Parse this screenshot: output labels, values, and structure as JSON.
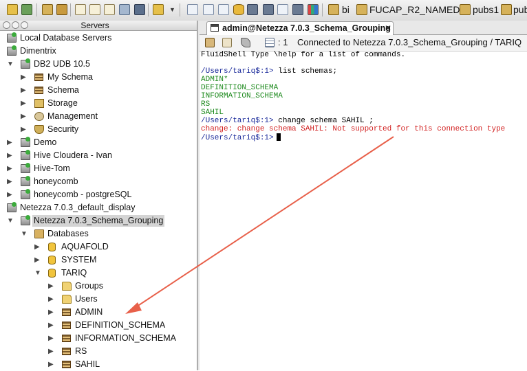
{
  "toolbar": {
    "items": [
      "toolbar-icon",
      "toolbar-icon",
      "toolbar-icon",
      "toolbar-icon",
      "toolbar-icon",
      "toolbar-icon",
      "toolbar-icon",
      "toolbar-icon",
      "toolbar-icon"
    ],
    "connections": [
      "bi",
      "FUCAP_R2_NAMED",
      "pubs1",
      "pub"
    ]
  },
  "servers_panel": {
    "title": "Servers",
    "tree": [
      {
        "label": "Local Database Servers",
        "icon": "server-group-icon",
        "depth": 0,
        "expander": ""
      },
      {
        "label": "Dimentrix",
        "icon": "server-icon",
        "depth": 0,
        "expander": ""
      },
      {
        "label": "DB2 UDB 10.5",
        "icon": "server-icon",
        "depth": 0,
        "expander": "open"
      },
      {
        "label": "My Schema",
        "icon": "schema-icon",
        "depth": 1,
        "expander": "closed"
      },
      {
        "label": "Schema",
        "icon": "schema-icon",
        "depth": 1,
        "expander": "closed"
      },
      {
        "label": "Storage",
        "icon": "storage-icon",
        "depth": 1,
        "expander": "closed"
      },
      {
        "label": "Management",
        "icon": "gear-icon",
        "depth": 1,
        "expander": "closed"
      },
      {
        "label": "Security",
        "icon": "shield-icon",
        "depth": 1,
        "expander": "closed"
      },
      {
        "label": "Demo",
        "icon": "server-icon",
        "depth": 0,
        "expander": "closed"
      },
      {
        "label": "Hive Cloudera - Ivan",
        "icon": "server-icon",
        "depth": 0,
        "expander": "closed"
      },
      {
        "label": "Hive-Tom",
        "icon": "server-icon",
        "depth": 0,
        "expander": "closed"
      },
      {
        "label": "honeycomb",
        "icon": "server-icon",
        "depth": 0,
        "expander": "closed"
      },
      {
        "label": "honeycomb - postgreSQL",
        "icon": "server-icon",
        "depth": 0,
        "expander": "closed"
      },
      {
        "label": "Netezza 7.0.3_default_display",
        "icon": "server-icon",
        "depth": 0,
        "expander": ""
      },
      {
        "label": "Netezza 7.0.3_Schema_Grouping",
        "icon": "server-icon",
        "depth": 0,
        "expander": "open",
        "selected": true
      },
      {
        "label": "Databases",
        "icon": "databases-folder-icon",
        "depth": 1,
        "expander": "open"
      },
      {
        "label": "AQUAFOLD",
        "icon": "database-icon",
        "depth": 2,
        "expander": "closed"
      },
      {
        "label": "SYSTEM",
        "icon": "database-icon",
        "depth": 2,
        "expander": "closed"
      },
      {
        "label": "TARIQ",
        "icon": "database-icon",
        "depth": 2,
        "expander": "open"
      },
      {
        "label": "Groups",
        "icon": "folder-icon",
        "depth": 3,
        "expander": "closed"
      },
      {
        "label": "Users",
        "icon": "folder-icon",
        "depth": 3,
        "expander": "closed"
      },
      {
        "label": "ADMIN",
        "icon": "schema-icon",
        "depth": 3,
        "expander": "closed"
      },
      {
        "label": "DEFINITION_SCHEMA",
        "icon": "schema-icon",
        "depth": 3,
        "expander": "closed"
      },
      {
        "label": "INFORMATION_SCHEMA",
        "icon": "schema-icon",
        "depth": 3,
        "expander": "closed"
      },
      {
        "label": "RS",
        "icon": "schema-icon",
        "depth": 3,
        "expander": "closed"
      },
      {
        "label": "SAHIL",
        "icon": "schema-icon",
        "depth": 3,
        "expander": "closed"
      }
    ]
  },
  "editor": {
    "tab_title": "admin@Netezza 7.0.3_Schema_Grouping",
    "tab_close": "✕",
    "shell_count": ": 1",
    "status": "Connected to Netezza 7.0.3_Schema_Grouping / TARIQ",
    "console": [
      {
        "text": "FluidShell Type \\help for a list of commands.",
        "style": "black"
      },
      {
        "text": "",
        "style": "black"
      },
      {
        "prompt": "/Users/tariq$:1>",
        "text": " list schemas;",
        "style": "cmd"
      },
      {
        "text": "ADMIN*",
        "style": "green"
      },
      {
        "text": "DEFINITION_SCHEMA",
        "style": "green"
      },
      {
        "text": "INFORMATION_SCHEMA",
        "style": "green"
      },
      {
        "text": "RS",
        "style": "green"
      },
      {
        "text": "SAHIL",
        "style": "green"
      },
      {
        "prompt": "/Users/tariq$:1>",
        "text": " change schema SAHIL ;",
        "style": "cmd"
      },
      {
        "text": "change: change schema SAHIL: Not supported for this connection type",
        "style": "err"
      },
      {
        "prompt": "/Users/tariq$:1>",
        "text": "",
        "style": "cmd",
        "cursor": true
      }
    ]
  },
  "colors": {
    "arrow": "#e8604a",
    "prompt": "#1a2a9a",
    "listing": "#1e8a1e",
    "error": "#d22222"
  }
}
